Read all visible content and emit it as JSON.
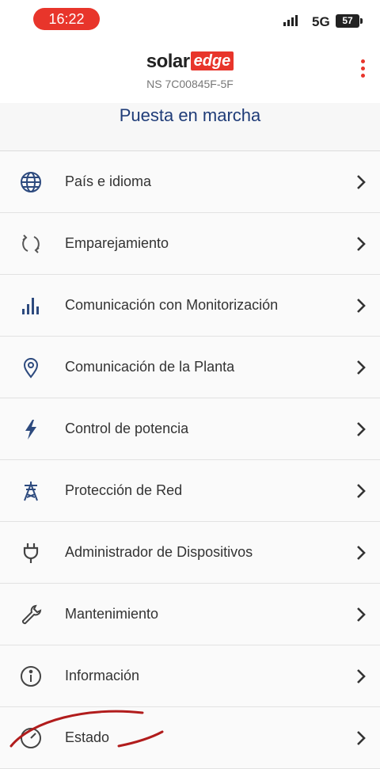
{
  "status_bar": {
    "time": "16:22",
    "network": "5G",
    "battery": "57"
  },
  "header": {
    "logo_solar": "solar",
    "logo_edge": "edge",
    "serial": "NS 7C00845F-5F",
    "menu_icon": "kebab-menu-icon"
  },
  "page": {
    "title": "Puesta en marcha"
  },
  "menu": {
    "items": [
      {
        "label": "País e idioma",
        "icon": "globe-icon"
      },
      {
        "label": "Emparejamiento",
        "icon": "sync-icon"
      },
      {
        "label": "Comunicación con Monitorización",
        "icon": "bar-chart-icon"
      },
      {
        "label": "Comunicación de la Planta",
        "icon": "location-pin-icon"
      },
      {
        "label": "Control de potencia",
        "icon": "lightning-icon"
      },
      {
        "label": "Protección de Red",
        "icon": "power-tower-icon"
      },
      {
        "label": "Administrador de Dispositivos",
        "icon": "plug-icon"
      },
      {
        "label": "Mantenimiento",
        "icon": "wrench-icon"
      },
      {
        "label": "Información",
        "icon": "info-icon"
      },
      {
        "label": "Estado",
        "icon": "gauge-icon"
      }
    ]
  },
  "colors": {
    "brand_red": "#e8352b",
    "title_blue": "#1f3c78",
    "icon_blue": "#2d4a7e"
  }
}
